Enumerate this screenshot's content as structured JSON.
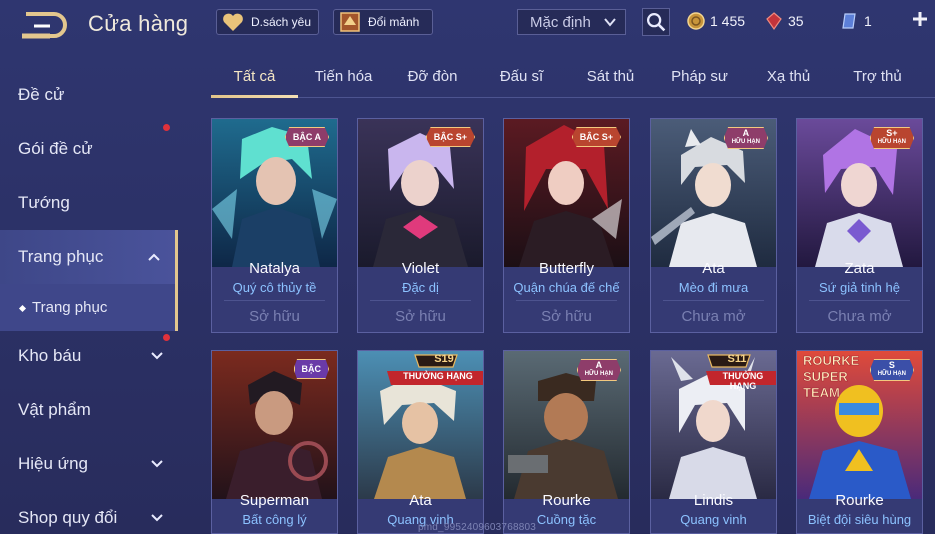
{
  "header": {
    "title": "Cửa hàng",
    "wishlist_label": "D.sách yêu",
    "exchange_label": "Đổi mảnh",
    "sort_value": "Mặc định",
    "currencies": [
      {
        "icon": "gold-coin-icon",
        "value": "1 455"
      },
      {
        "icon": "red-gem-icon",
        "value": "35"
      },
      {
        "icon": "voucher-icon",
        "value": "1"
      }
    ]
  },
  "sidebar": {
    "items": [
      {
        "label": "Đề cử"
      },
      {
        "label": "Gói đề cử"
      },
      {
        "label": "Tướng"
      },
      {
        "label": "Trang phục"
      },
      {
        "label": "Trang phục"
      },
      {
        "label": "Kho báu"
      },
      {
        "label": "Vật phẩm"
      },
      {
        "label": "Hiệu ứng"
      },
      {
        "label": "Shop quy đổi"
      }
    ]
  },
  "tabs": [
    "Tất cả",
    "Tiến hóa",
    "Đỡ đòn",
    "Đấu sĩ",
    "Sát thủ",
    "Pháp sư",
    "Xạ thủ",
    "Trợ thủ"
  ],
  "cards": [
    {
      "name": "Natalya",
      "skin": "Quý cô thủy tề",
      "status": "Sở hữu",
      "badge": "BẬC A"
    },
    {
      "name": "Violet",
      "skin": "Đặc dị",
      "status": "Sở hữu",
      "badge": "BẬC S+"
    },
    {
      "name": "Butterfly",
      "skin": "Quận chúa đế chế",
      "status": "Sở hữu",
      "badge": "BẬC S+"
    },
    {
      "name": "Ata",
      "skin": "Mèo đi mưa",
      "status": "Chưa mở",
      "badge": "A",
      "badge_sub": "HỮU HẠN"
    },
    {
      "name": "Zata",
      "skin": "Sứ giả tinh hệ",
      "status": "Chưa mở",
      "badge": "S+",
      "badge_sub": "HỮU HẠN"
    },
    {
      "name": "Superman",
      "skin": "Bất công lý",
      "badge": "BẬC"
    },
    {
      "name": "Ata",
      "skin": "Quang vinh",
      "rank": "S19",
      "rank_label": "THƯỞNG HẠNG"
    },
    {
      "name": "Rourke",
      "skin": "Cuồng tặc",
      "badge": "A",
      "badge_sub": "HỮU HẠN"
    },
    {
      "name": "Lindis",
      "skin": "Quang vinh",
      "rank": "S11",
      "rank_label": "THƯỞNG HẠNG"
    },
    {
      "name": "Rourke",
      "skin": "Biệt đội siêu hùng",
      "badge": "S",
      "badge_sub": "HỮU HẠN",
      "banner": "ROURKE SUPER TEAM"
    }
  ],
  "watermark": "pmd_9952409603768803",
  "colors": {
    "accent_gold": "#e2c489",
    "skin_blue": "#8cc2ff",
    "notification_red": "#e0313b"
  }
}
